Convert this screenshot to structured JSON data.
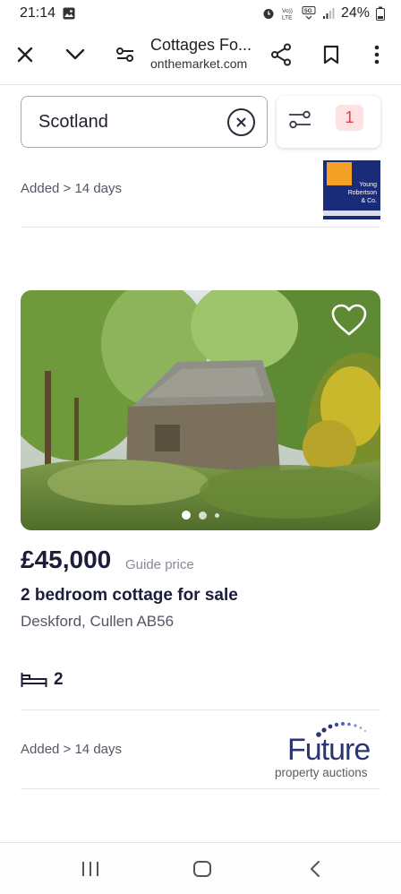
{
  "status_bar": {
    "time": "21:14",
    "battery": "24%"
  },
  "browser": {
    "title": "Cottages Fo...",
    "domain": "onthemarket.com"
  },
  "search": {
    "value": "Scotland",
    "filter_count": "1"
  },
  "listings": [
    {
      "added": "Added > 14 days",
      "agent_logo_text": "Young Robertson & Co."
    },
    {
      "price": "£45,000",
      "price_qualifier": "Guide price",
      "title": "2 bedroom cottage for sale",
      "address": "Deskford, Cullen AB56",
      "bedrooms": "2",
      "added": "Added > 14 days",
      "agent_logo_main": "Future",
      "agent_logo_sub": "property auctions",
      "photo_count_shown": 3,
      "photo_index_active": 1
    }
  ],
  "colors": {
    "brand_navy": "#1b1d3a",
    "filter_badge_bg": "#fde1e3",
    "filter_badge_text": "#d64550"
  }
}
